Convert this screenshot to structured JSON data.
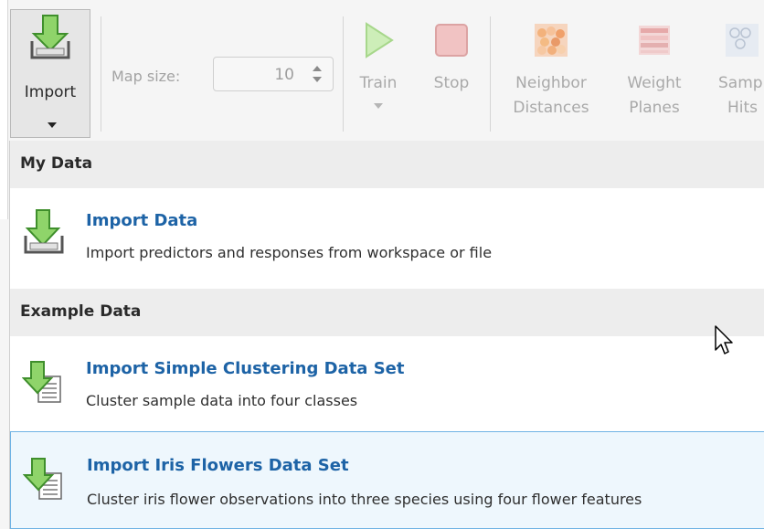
{
  "toolstrip": {
    "import_button": {
      "label": "Import"
    },
    "map_size": {
      "label": "Map size:",
      "value": "10"
    },
    "train": {
      "label": "Train"
    },
    "stop": {
      "label": "Stop"
    },
    "neighbor_distances": {
      "line1": "Neighbor",
      "line2": "Distances"
    },
    "weight_planes": {
      "line1": "Weight",
      "line2": "Planes"
    },
    "sample_hits": {
      "line1": "Samp",
      "line2": "Hits"
    }
  },
  "menu": {
    "my_data": {
      "header": "My Data",
      "items": [
        {
          "title": "Import Data",
          "description": "Import predictors and responses from workspace or file",
          "icon": "import-data-icon"
        }
      ]
    },
    "example_data": {
      "header": "Example Data",
      "items": [
        {
          "title": "Import Simple Clustering Data Set",
          "description": "Cluster sample data into four classes",
          "icon": "import-dataset-icon"
        },
        {
          "title": "Import Iris Flowers Data Set",
          "description": "Cluster iris flower observations into three species using four flower features",
          "icon": "import-dataset-icon"
        }
      ]
    }
  },
  "colors": {
    "accent_title": "#1d63a6",
    "hover_bg": "#eef7fd",
    "hover_border": "#6fb3e4",
    "icon_green": "#5fa83c"
  }
}
